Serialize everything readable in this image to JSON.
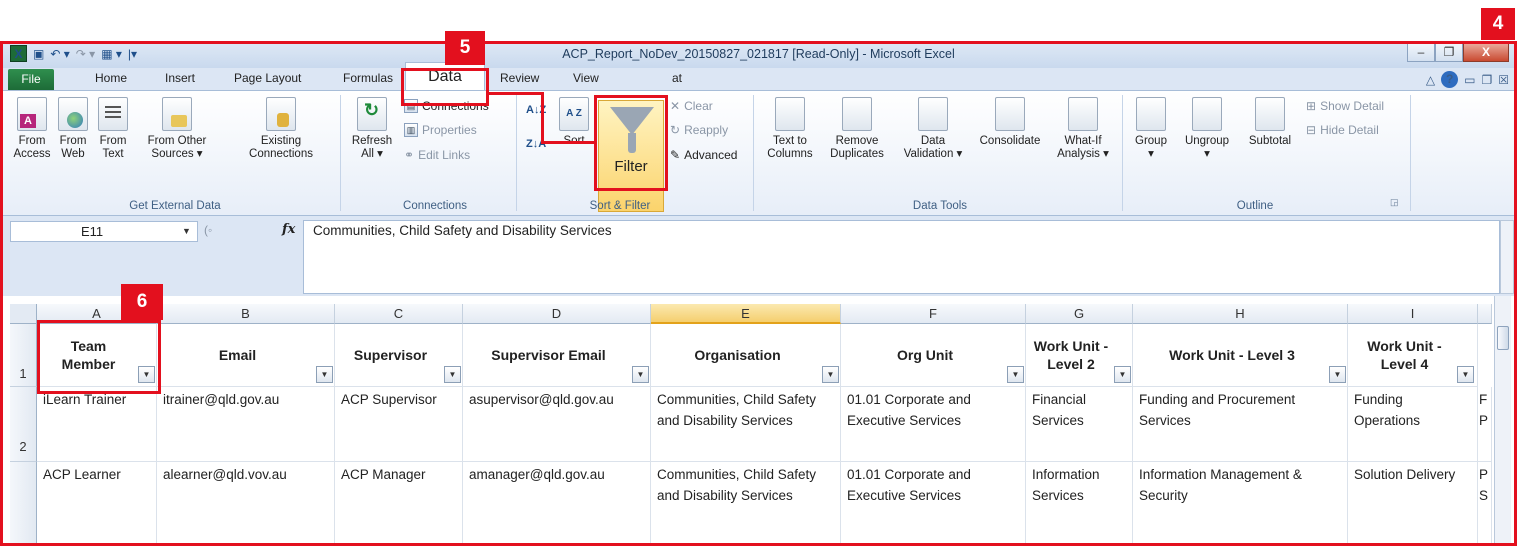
{
  "window": {
    "title": "ACP_Report_NoDev_20150827_021817  [Read-Only]  -  Microsoft Excel",
    "minimize": "–",
    "restore": "❐",
    "close": "X"
  },
  "badges": {
    "b4": "4",
    "b5": "5",
    "b6": "6"
  },
  "tabs": {
    "file": "File",
    "home": "Home",
    "insert": "Insert",
    "page_layout": "Page Layout",
    "formulas": "Formulas",
    "data": "Data",
    "review": "Review",
    "view": "View",
    "format": "at"
  },
  "ribbon": {
    "get_external_data": {
      "label": "Get External Data",
      "from_access": [
        "From",
        "Access"
      ],
      "from_web": [
        "From",
        "Web"
      ],
      "from_text": [
        "From",
        "Text"
      ],
      "from_other": [
        "From Other",
        "Sources ▾"
      ],
      "existing": [
        "Existing",
        "Connections"
      ]
    },
    "connections": {
      "label": "Connections",
      "refresh": [
        "Refresh",
        "All ▾"
      ],
      "connections": "Connections",
      "properties": "Properties",
      "edit_links": "Edit Links"
    },
    "sort_filter": {
      "label": "Sort & Filter",
      "sort": "Sort",
      "filter": "Filter",
      "clear": "Clear",
      "reapply": "Reapply",
      "advanced": "Advanced"
    },
    "data_tools": {
      "label": "Data Tools",
      "text_to_columns": [
        "Text to",
        "Columns"
      ],
      "remove_duplicates": [
        "Remove",
        "Duplicates"
      ],
      "data_validation": [
        "Data",
        "Validation ▾"
      ],
      "consolidate": "Consolidate",
      "what_if": [
        "What-If",
        "Analysis ▾"
      ]
    },
    "outline": {
      "label": "Outline",
      "group": [
        "Group",
        "▾"
      ],
      "ungroup": [
        "Ungroup",
        "▾"
      ],
      "subtotal": "Subtotal",
      "show_detail": "Show Detail",
      "hide_detail": "Hide Detail"
    }
  },
  "formula_bar": {
    "name_box": "E11",
    "fx": "fx",
    "content": "Communities, Child Safety and Disability Services"
  },
  "grid": {
    "columns": [
      "A",
      "B",
      "C",
      "D",
      "E",
      "F",
      "G",
      "H",
      "I"
    ],
    "rows": [
      "1",
      "2"
    ],
    "headers": [
      "Team Member",
      "Email",
      "Supervisor",
      "Supervisor Email",
      "Organisation",
      "Org Unit",
      "Work Unit - Level 2",
      "Work Unit - Level 3",
      "Work Unit - Level 4"
    ],
    "data": [
      [
        "iLearn Trainer",
        "itrainer@qld.gov.au",
        "ACP Supervisor",
        "asupervisor@qld.gov.au",
        "Communities, Child Safety and Disability Services",
        "01.01 Corporate and Executive Services",
        "Financial Services",
        "Funding and Procurement Services",
        "Funding Operations",
        "F P"
      ],
      [
        "ACP Learner",
        "alearner@qld.vov.au",
        "ACP Manager",
        "amanager@qld.gov.au",
        "Communities, Child Safety and Disability Services",
        "01.01 Corporate and Executive Services",
        "Information Services",
        "Information Management & Security",
        "Solution Delivery",
        "P S"
      ]
    ]
  }
}
